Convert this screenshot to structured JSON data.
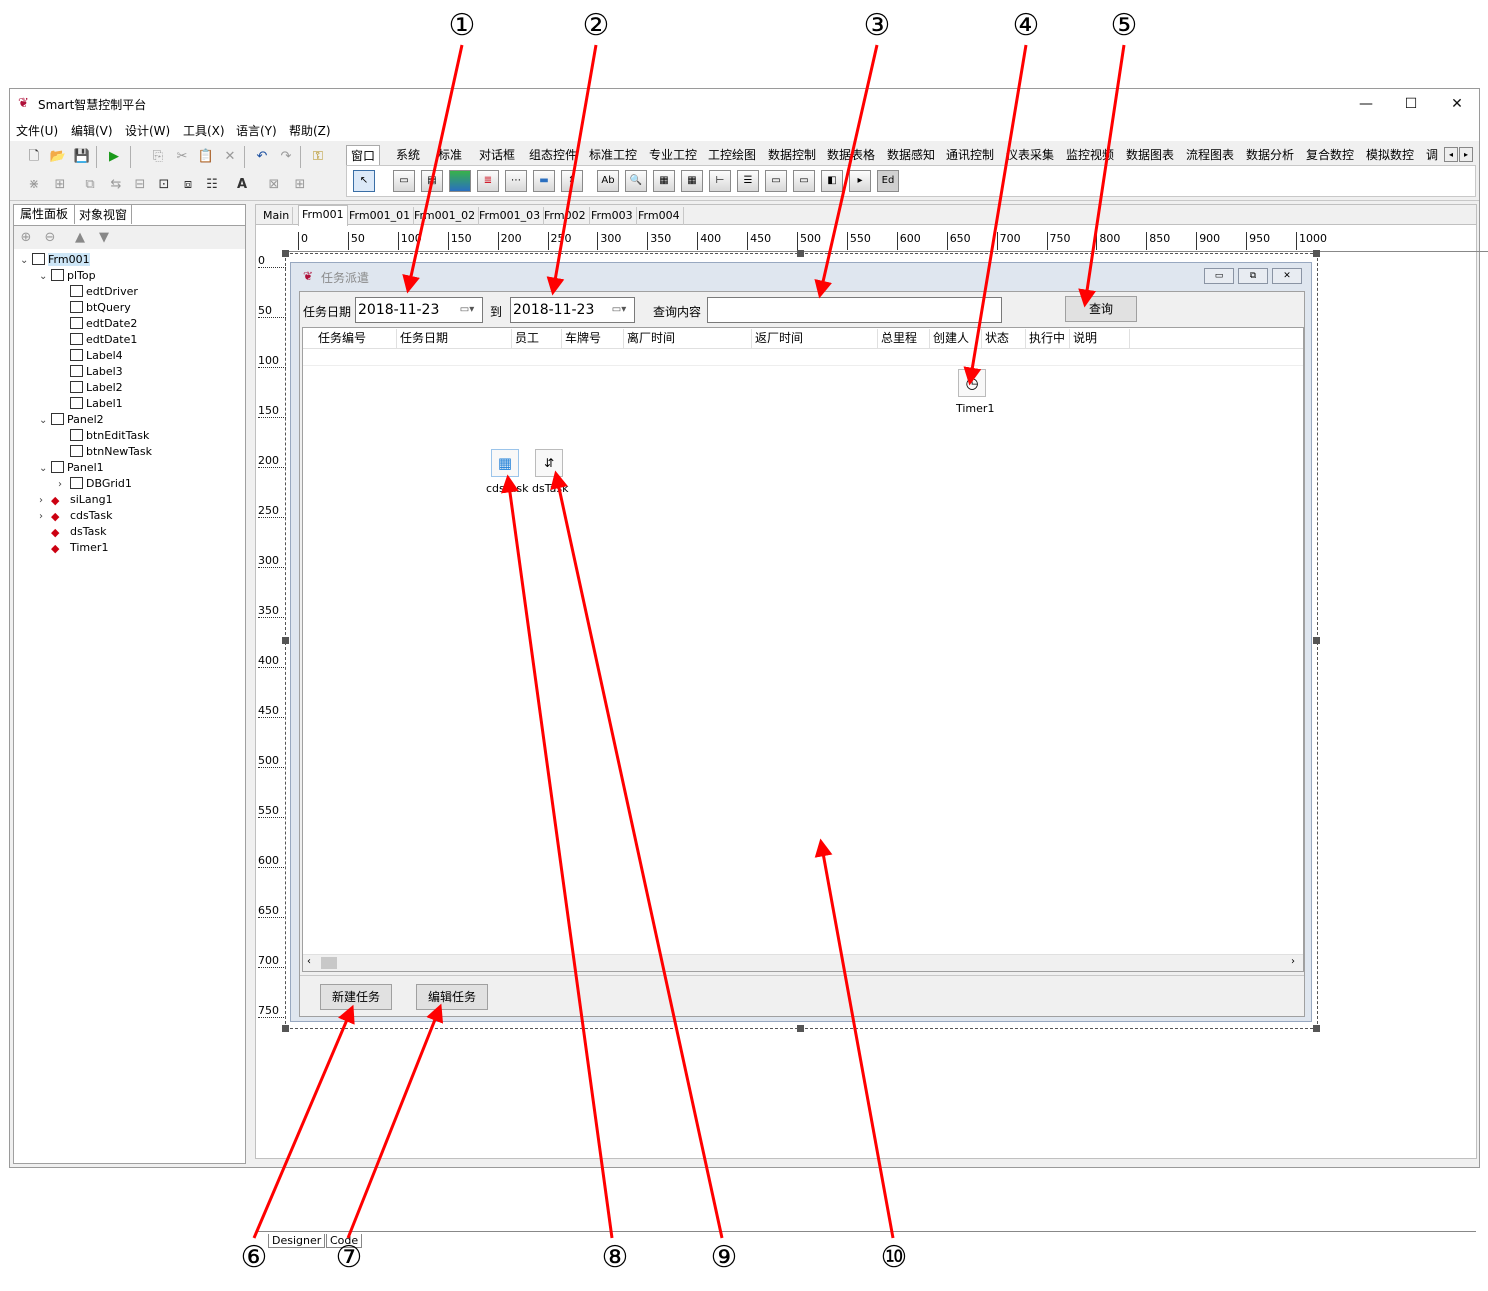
{
  "window": {
    "title": "Smart智慧控制平台",
    "controls": [
      "—",
      "☐",
      "✕"
    ]
  },
  "menu": [
    "文件(U)",
    "编辑(V)",
    "设计(W)",
    "工具(X)",
    "语言(Y)",
    "帮助(Z)"
  ],
  "palette_tabs": [
    "窗口",
    "系统",
    "标准",
    "对话框",
    "组态控件",
    "标准工控",
    "专业工控",
    "工控绘图",
    "数据控制",
    "数据表格",
    "数据感知",
    "通讯控制",
    "仪表采集",
    "监控视频",
    "数据图表",
    "流程图表",
    "数据分析",
    "复合数控",
    "模拟数控",
    "调"
  ],
  "left_panel": {
    "tabs": [
      "属性面板",
      "对象视窗"
    ],
    "tree": [
      {
        "label": "Frm001",
        "level": 0,
        "expander": "v",
        "kind": "form"
      },
      {
        "label": "plTop",
        "level": 1,
        "expander": "v",
        "kind": "panel"
      },
      {
        "label": "edtDriver",
        "level": 2,
        "expander": "",
        "kind": "ctl"
      },
      {
        "label": "btQuery",
        "level": 2,
        "expander": "",
        "kind": "ctl"
      },
      {
        "label": "edtDate2",
        "level": 2,
        "expander": "",
        "kind": "ctl"
      },
      {
        "label": "edtDate1",
        "level": 2,
        "expander": "",
        "kind": "ctl"
      },
      {
        "label": "Label4",
        "level": 2,
        "expander": "",
        "kind": "ctl"
      },
      {
        "label": "Label3",
        "level": 2,
        "expander": "",
        "kind": "ctl"
      },
      {
        "label": "Label2",
        "level": 2,
        "expander": "",
        "kind": "ctl"
      },
      {
        "label": "Label1",
        "level": 2,
        "expander": "",
        "kind": "ctl"
      },
      {
        "label": "Panel2",
        "level": 1,
        "expander": "v",
        "kind": "panel"
      },
      {
        "label": "btnEditTask",
        "level": 2,
        "expander": "",
        "kind": "ctl"
      },
      {
        "label": "btnNewTask",
        "level": 2,
        "expander": "",
        "kind": "ctl"
      },
      {
        "label": "Panel1",
        "level": 1,
        "expander": "v",
        "kind": "panel"
      },
      {
        "label": "DBGrid1",
        "level": 2,
        "expander": ">",
        "kind": "ctl"
      },
      {
        "label": "siLang1",
        "level": 1,
        "expander": ">",
        "kind": "comp"
      },
      {
        "label": "cdsTask",
        "level": 1,
        "expander": ">",
        "kind": "comp"
      },
      {
        "label": "dsTask",
        "level": 1,
        "expander": "",
        "kind": "comp"
      },
      {
        "label": "Timer1",
        "level": 1,
        "expander": "",
        "kind": "comp"
      }
    ]
  },
  "doc_tabs": [
    "Main",
    "Frm001",
    "Frm001_01",
    "Frm001_02",
    "Frm001_03",
    "Frm002",
    "Frm003",
    "Frm004"
  ],
  "ruler_h": [
    "0",
    "50",
    "100",
    "150",
    "200",
    "250",
    "300",
    "350",
    "400",
    "450",
    "500",
    "550",
    "600",
    "650",
    "700",
    "750",
    "800",
    "850",
    "900",
    "950",
    "1000"
  ],
  "ruler_v": [
    "0",
    "50",
    "100",
    "150",
    "200",
    "250",
    "300",
    "350",
    "400",
    "450",
    "500",
    "550",
    "600",
    "650",
    "700",
    "750"
  ],
  "form": {
    "title": "任务派遣",
    "date_label": "任务日期",
    "date_from": "2018-11-23",
    "to_label": "到",
    "date_to": "2018-11-23",
    "query_label": "查询内容",
    "query_value": "",
    "query_button": "查询",
    "columns": [
      "任务编号",
      "任务日期",
      "员工",
      "车牌号",
      "离厂时间",
      "返厂时间",
      "总里程",
      "创建人",
      "状态",
      "执行中",
      "说明"
    ],
    "new_task_button": "新建任务",
    "edit_task_button": "编辑任务",
    "components": {
      "timer": "Timer1",
      "cds": "cdsTask",
      "ds": "dsTask"
    }
  },
  "bottom_tabs": [
    "Designer",
    "Code"
  ],
  "callouts": [
    "①",
    "②",
    "③",
    "④",
    "⑤",
    "⑥",
    "⑦",
    "⑧",
    "⑨",
    "⑩"
  ],
  "colors": {
    "annotation_arrow": "#ff0000",
    "form_caption_bg": "#dfe6ef",
    "grid_bg": "#ffffff"
  }
}
